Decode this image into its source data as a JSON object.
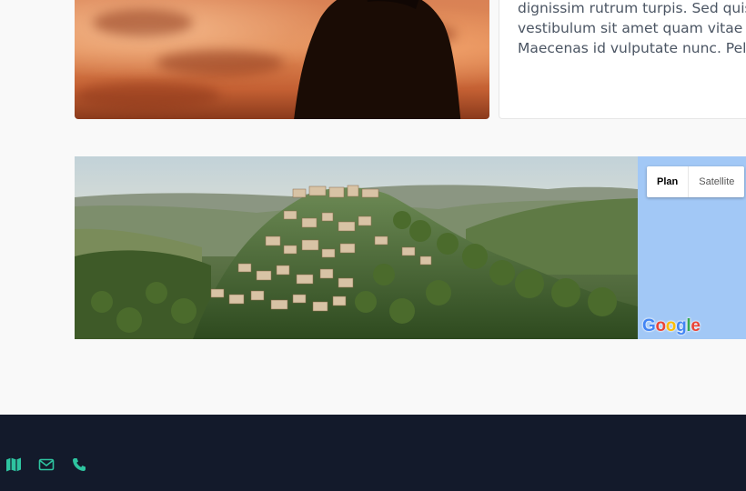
{
  "text_card": {
    "lines": [
      "dignissim rutrum turpis. Sed quis",
      "vestibulum sit amet quam vitae tr",
      "Maecenas id vulputate nunc. Pelle"
    ]
  },
  "hero_photo": {
    "alt": "Silhouette against a sunset sky"
  },
  "map": {
    "photo_alt": "Hilltop village above a green valley",
    "type_control": {
      "plan_label": "Plan",
      "satellite_label": "Satellite",
      "selected": "Plan"
    },
    "logo_letters": [
      "G",
      "o",
      "o",
      "g",
      "l",
      "e"
    ]
  },
  "footer": {
    "icons": [
      "map-icon",
      "envelope-icon",
      "phone-icon"
    ],
    "accent_color": "#2ec4a0",
    "background_color": "#131a2b"
  }
}
